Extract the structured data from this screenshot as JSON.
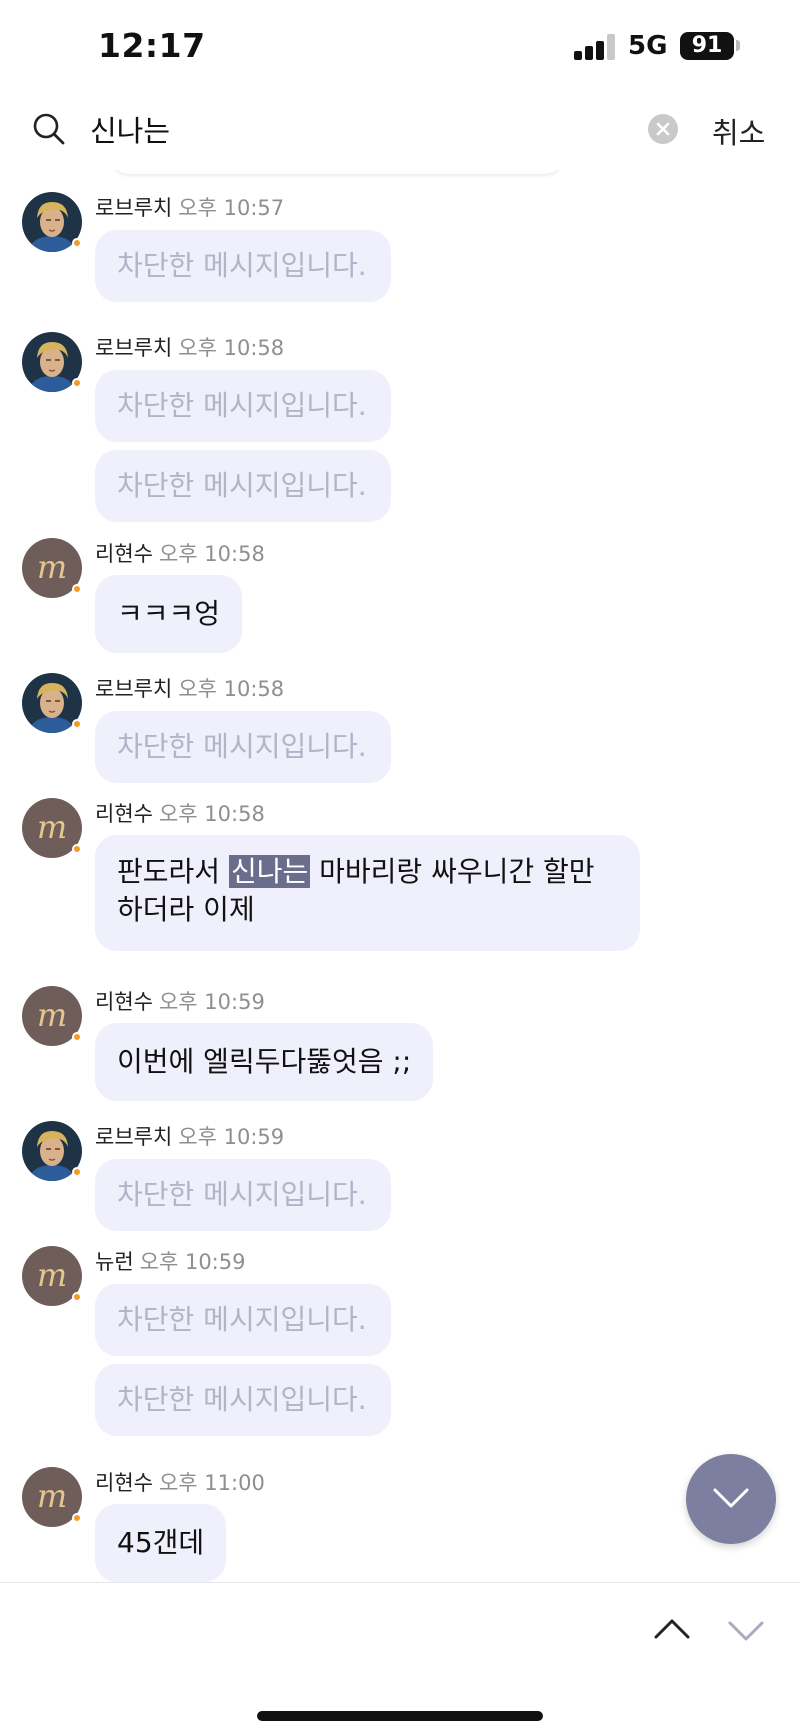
{
  "status_bar": {
    "time": "12:17",
    "network": "5G",
    "battery": "91"
  },
  "search": {
    "query": "신나는",
    "cancel_label": "취소"
  },
  "colors": {
    "bubble": "#eff0fb",
    "highlight": "#6b6d8c",
    "fab": "#7c7fa0",
    "online": "#f39a2a"
  },
  "messages": [
    {
      "sender": "로브루치",
      "time": "오후 10:57",
      "avatar": "portrait-avatar",
      "bubbles": [
        "차단한 메시지입니다."
      ]
    },
    {
      "sender": "로브루치",
      "time": "오후 10:58",
      "avatar": "portrait-avatar",
      "bubbles": [
        "차단한 메시지입니다.",
        "차단한 메시지입니다."
      ]
    },
    {
      "sender": "리현수",
      "time": "오후 10:58",
      "avatar": "m-logo-avatar",
      "bubbles": [
        "ㅋㅋㅋ엉"
      ]
    },
    {
      "sender": "로브루치",
      "time": "오후 10:58",
      "avatar": "portrait-avatar",
      "bubbles": [
        "차단한 메시지입니다."
      ]
    },
    {
      "sender": "리현수",
      "time": "오후 10:58",
      "avatar": "m-logo-avatar",
      "text_before": "판도라서 ",
      "text_highlight": "신나는",
      "text_after_line1": " 마바리랑 싸우니간 할만",
      "text_line2": "하더라 이제"
    },
    {
      "sender": "리현수",
      "time": "오후 10:59",
      "avatar": "m-logo-avatar",
      "bubbles": [
        "이번에 엘릭두다뚫엇음 ;;"
      ]
    },
    {
      "sender": "로브루치",
      "time": "오후 10:59",
      "avatar": "portrait-avatar",
      "bubbles": [
        "차단한 메시지입니다."
      ]
    },
    {
      "sender": "뉴런",
      "time": "오후 10:59",
      "avatar": "m-logo-avatar",
      "bubbles": [
        "차단한 메시지입니다.",
        "차단한 메시지입니다."
      ]
    },
    {
      "sender": "리현수",
      "time": "오후 11:00",
      "avatar": "m-logo-avatar",
      "bubbles": [
        "45갠데"
      ]
    }
  ],
  "icons": {
    "search": "search-icon",
    "clear": "clear-icon",
    "scroll_down": "chevron-down-icon",
    "prev": "chevron-up-icon",
    "next": "chevron-down-icon"
  }
}
